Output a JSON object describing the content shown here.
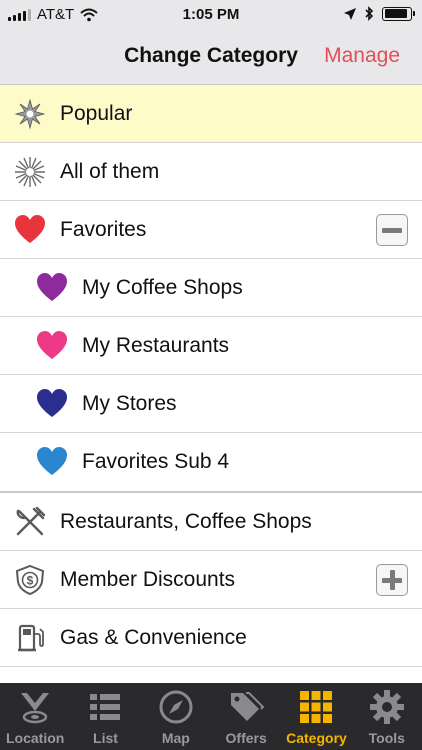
{
  "status_bar": {
    "carrier": "AT&T",
    "time": "1:05 PM",
    "battery_level": 0.9
  },
  "nav": {
    "title": "Change Category",
    "manage_label": "Manage"
  },
  "rows": [
    {
      "label": "Popular",
      "icon": "starburst-icon",
      "highlighted": true
    },
    {
      "label": "All of them",
      "icon": "sparkle-icon"
    },
    {
      "label": "Favorites",
      "icon": "heart-icon",
      "icon_color": "#e8353b",
      "toggle": "minus"
    },
    {
      "label": "My Coffee Shops",
      "icon": "heart-icon",
      "icon_color": "#8e2a9c",
      "sub": true
    },
    {
      "label": "My Restaurants",
      "icon": "heart-icon",
      "icon_color": "#ec3a87",
      "sub": true
    },
    {
      "label": "My Stores",
      "icon": "heart-icon",
      "icon_color": "#2a2f8f",
      "sub": true
    },
    {
      "label": "Favorites Sub 4",
      "icon": "heart-icon",
      "icon_color": "#2a86cf",
      "sub": true
    },
    {
      "label": "Restaurants, Coffee Shops",
      "icon": "fork-knife-icon"
    },
    {
      "label": "Member Discounts",
      "icon": "dollar-shield-icon",
      "toggle": "plus"
    },
    {
      "label": "Gas & Convenience",
      "icon": "gas-pump-icon"
    }
  ],
  "tabs": [
    {
      "label": "Location",
      "icon": "location-pin-icon",
      "active": false
    },
    {
      "label": "List",
      "icon": "list-icon",
      "active": false
    },
    {
      "label": "Map",
      "icon": "compass-icon",
      "active": false
    },
    {
      "label": "Offers",
      "icon": "tags-icon",
      "active": false
    },
    {
      "label": "Category",
      "icon": "grid-icon",
      "active": true
    },
    {
      "label": "Tools",
      "icon": "gear-icon",
      "active": false
    }
  ],
  "colors": {
    "accent": "#e0505a",
    "tab_active": "#f4b400",
    "highlight_row": "#fdfbc8"
  }
}
